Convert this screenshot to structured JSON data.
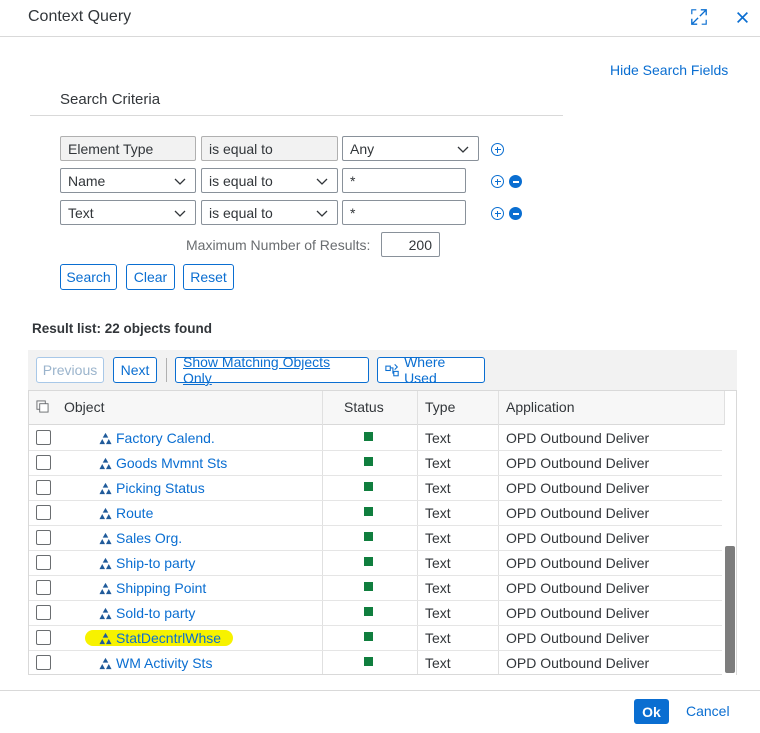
{
  "dialog": {
    "title": "Context Query",
    "hide_search_fields": "Hide Search Fields",
    "ok": "Ok",
    "cancel": "Cancel"
  },
  "search": {
    "title": "Search Criteria",
    "rows": [
      {
        "field": "Element Type",
        "operator": "is equal to",
        "value": "Any"
      },
      {
        "field": "Name",
        "operator": "is equal to",
        "value": "*"
      },
      {
        "field": "Text",
        "operator": "is equal to",
        "value": "*"
      }
    ],
    "max_results_label": "Maximum Number of Results:",
    "max_results_value": "200",
    "buttons": {
      "search": "Search",
      "clear": "Clear",
      "reset": "Reset"
    }
  },
  "results": {
    "summary": "Result list: 22  objects found",
    "toolbar": {
      "previous": "Previous",
      "next": "Next",
      "show_matching": "Show Matching Objects Only",
      "where_used": "Where Used"
    },
    "columns": {
      "object": "Object",
      "status": "Status",
      "type": "Type",
      "application": "Application"
    },
    "rows": [
      {
        "object": "Factory Calend.",
        "type": "Text",
        "application": "OPD Outbound Deliver"
      },
      {
        "object": "Goods Mvmnt Sts",
        "type": "Text",
        "application": "OPD Outbound Deliver"
      },
      {
        "object": "Picking Status",
        "type": "Text",
        "application": "OPD Outbound Deliver"
      },
      {
        "object": "Route",
        "type": "Text",
        "application": "OPD Outbound Deliver"
      },
      {
        "object": "Sales Org.",
        "type": "Text",
        "application": "OPD Outbound Deliver"
      },
      {
        "object": "Ship-to party",
        "type": "Text",
        "application": "OPD Outbound Deliver"
      },
      {
        "object": "Shipping Point",
        "type": "Text",
        "application": "OPD Outbound Deliver"
      },
      {
        "object": "Sold-to party",
        "type": "Text",
        "application": "OPD Outbound Deliver"
      },
      {
        "object": "StatDecntrlWhse",
        "type": "Text",
        "application": "OPD Outbound Deliver",
        "highlighted": true
      },
      {
        "object": "WM Activity Sts",
        "type": "Text",
        "application": "OPD Outbound Deliver"
      }
    ]
  },
  "colors": {
    "accent": "#0a6ed1",
    "status_ok": "#107e3e",
    "highlight": "#f7f200"
  }
}
